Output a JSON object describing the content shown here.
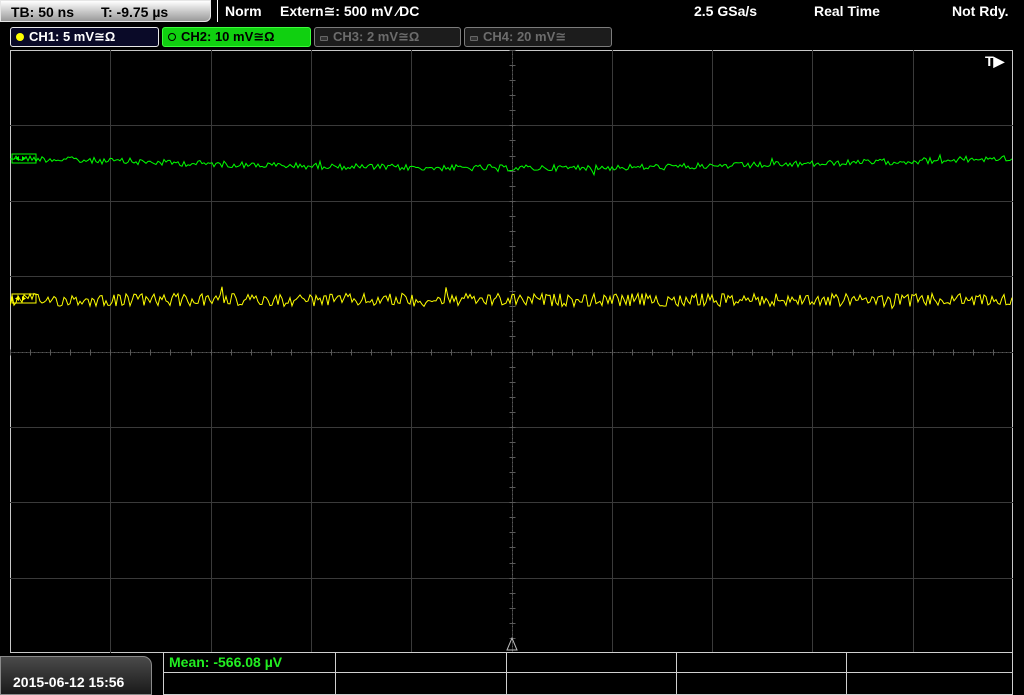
{
  "status": {
    "timebase": "TB: 50 ns",
    "trigger_time": "T: -9.75 µs",
    "trigger_mode": "Norm",
    "trigger_source": "Extern≅: 500 mV ⁄DC",
    "sample_rate": "2.5 GSa/s",
    "acquisition_mode": "Real Time",
    "run_state": "Not Rdy."
  },
  "channels": [
    {
      "label": "CH1: 5 mV≅Ω",
      "color": "#ffff00",
      "active": true
    },
    {
      "label": "CH2: 10 mV≅Ω",
      "color": "#00ff00",
      "active": true
    },
    {
      "label": "CH3: 2 mV≅Ω",
      "color": "#6c6c6c",
      "active": false
    },
    {
      "label": "CH4: 20 mV≅",
      "color": "#6c6c6c",
      "active": false
    }
  ],
  "display": {
    "trigger_marker": "T▶"
  },
  "measurements": {
    "mean": "Mean: -566.08 µV"
  },
  "datetime": "2015-06-12 15:56"
}
